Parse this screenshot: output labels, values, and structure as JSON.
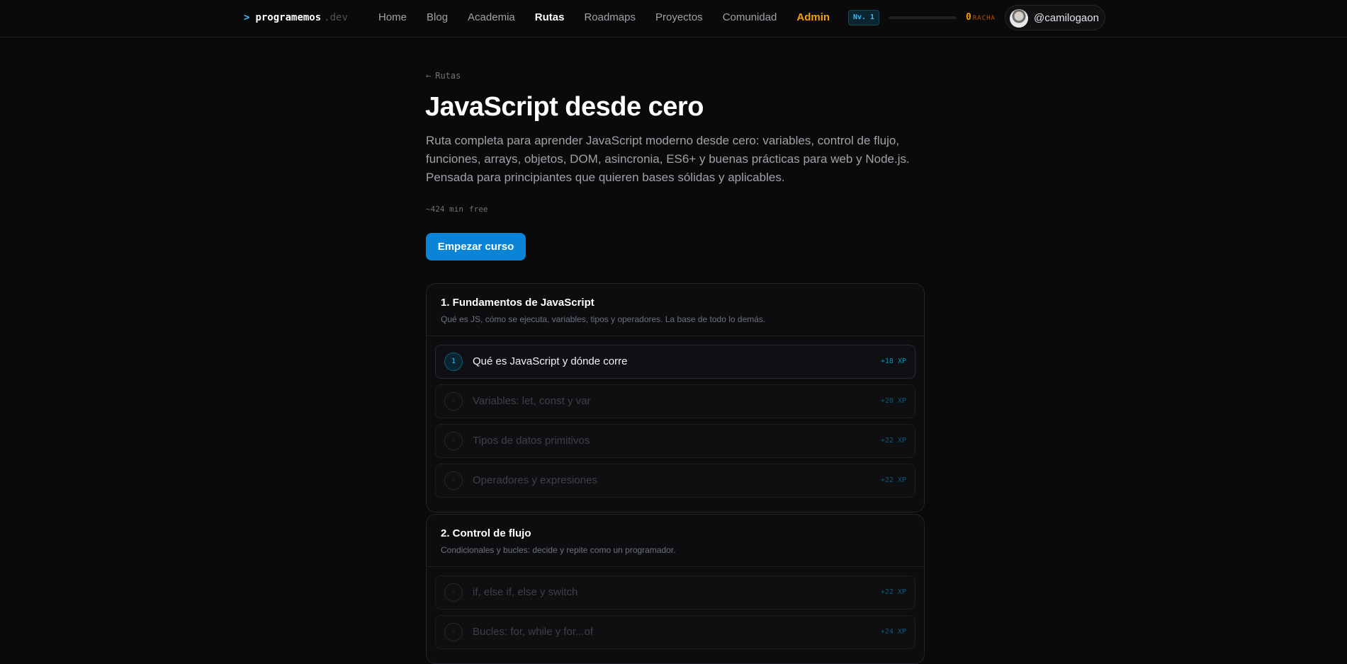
{
  "nav": {
    "logo": {
      "prompt": ">",
      "name": "programemos",
      "tld": ".dev"
    },
    "items": [
      {
        "label": "Home",
        "state": "normal"
      },
      {
        "label": "Blog",
        "state": "normal"
      },
      {
        "label": "Academia",
        "state": "normal"
      },
      {
        "label": "Rutas",
        "state": "active"
      },
      {
        "label": "Roadmaps",
        "state": "normal"
      },
      {
        "label": "Proyectos",
        "state": "normal"
      },
      {
        "label": "Comunidad",
        "state": "normal"
      },
      {
        "label": "Admin",
        "state": "admin"
      }
    ],
    "level": "Nv. 1",
    "xp_progress": 0,
    "streak_count": "0",
    "streak_label": "RACHA",
    "username": "@camilogaon"
  },
  "page": {
    "back_arrow": "←",
    "back_label": "Rutas",
    "title": "JavaScript desde cero",
    "description": "Ruta completa para aprender JavaScript moderno desde cero: variables, control de flujo, funciones, arrays, objetos, DOM, asincronia, ES6+ y buenas prácticas para web y Node.js. Pensada para principiantes que quieren bases sólidas y aplicables.",
    "duration": "~424 min",
    "tier": "free",
    "cta": "Empezar curso"
  },
  "modules": [
    {
      "title": "1. Fundamentos de JavaScript",
      "subtitle": "Qué es JS, cómo se ejecuta, variables, tipos y operadores. La base de todo lo demás.",
      "lessons": [
        {
          "badge": "1",
          "title": "Qué es JavaScript y dónde corre",
          "xp": "+18 XP",
          "active": true
        },
        {
          "badge": "·",
          "title": "Variables: let, const y var",
          "xp": "+20 XP",
          "active": false
        },
        {
          "badge": "·",
          "title": "Tipos de datos primitivos",
          "xp": "+22 XP",
          "active": false
        },
        {
          "badge": "·",
          "title": "Operadores y expresiones",
          "xp": "+22 XP",
          "active": false
        }
      ]
    },
    {
      "title": "2. Control de flujo",
      "subtitle": "Condicionales y bucles: decide y repite como un programador.",
      "lessons": [
        {
          "badge": "·",
          "title": "if, else if, else y switch",
          "xp": "+22 XP",
          "active": false
        },
        {
          "badge": "·",
          "title": "Bucles: for, while y for...of",
          "xp": "+24 XP",
          "active": false
        }
      ]
    }
  ]
}
